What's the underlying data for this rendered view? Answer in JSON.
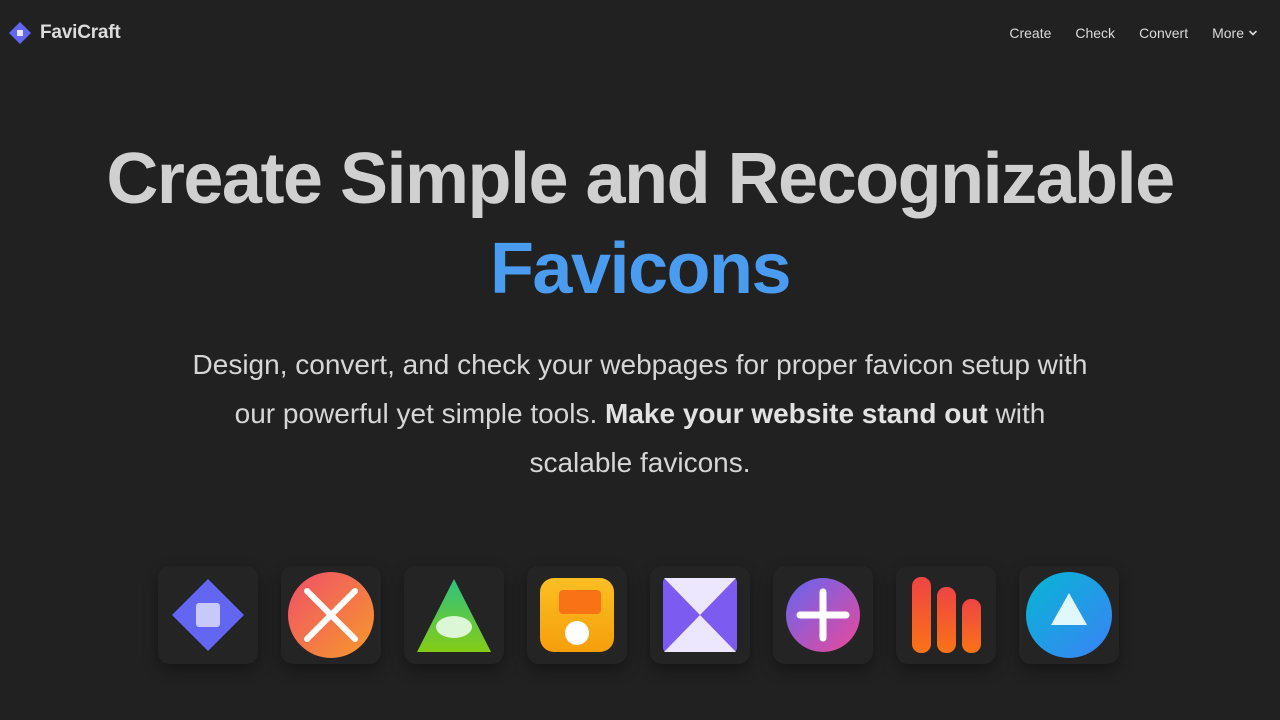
{
  "brand": {
    "name": "FaviCraft",
    "icon": "diamond-logo-icon"
  },
  "nav": {
    "links": [
      "Create",
      "Check",
      "Convert"
    ],
    "more_label": "More",
    "more_icon": "chevron-down-icon"
  },
  "hero": {
    "title_line1": "Create Simple and Recognizable",
    "title_line2": "Favicons",
    "subtitle_part1": "Design, convert, and check your webpages for proper favicon setup with our powerful yet simple tools.",
    "subtitle_bold": "Make your website stand out",
    "subtitle_part2": "with scalable favicons."
  },
  "colors": {
    "background": "#212121",
    "accent": "#4a9cf0",
    "brand_logo": "#6366f1"
  },
  "favicon_examples": [
    "blue-diamond-square-icon",
    "orange-circle-x-icon",
    "green-triangle-icon",
    "orange-rounded-square-icon",
    "purple-hourglass-icon",
    "gradient-circle-plus-icon",
    "orange-bars-icon",
    "blue-circle-triangle-icon"
  ]
}
